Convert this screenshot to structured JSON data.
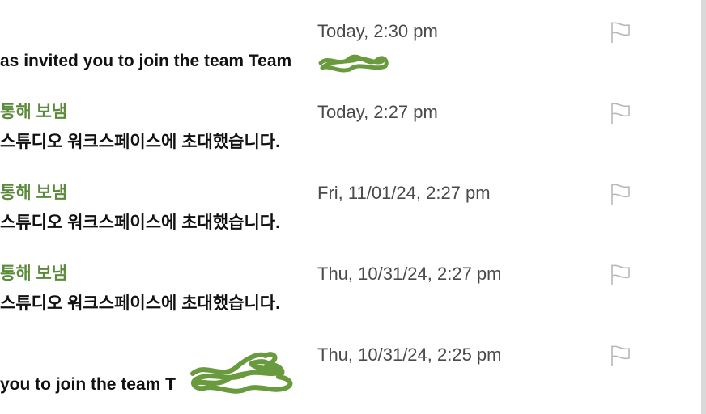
{
  "messages": [
    {
      "sender": "",
      "subject": "as invited you to join the team Team",
      "date": "Today, 2:30 pm"
    },
    {
      "sender": "통해 보냄",
      "subject": "스튜디오 워크스페이스에 초대했습니다.",
      "date": "Today, 2:27 pm"
    },
    {
      "sender": "통해 보냄",
      "subject": "스튜디오 워크스페이스에 초대했습니다.",
      "date": "Fri, 11/01/24, 2:27 pm"
    },
    {
      "sender": "통해 보냄",
      "subject": "스튜디오 워크스페이스에 초대했습니다.",
      "date": "Thu, 10/31/24, 2:27 pm"
    },
    {
      "sender": "",
      "subject": "you to join the team T",
      "date": "Thu, 10/31/24, 2:25 pm"
    }
  ],
  "icons": {
    "flag": "flag-icon",
    "redaction": "redaction-scribble"
  },
  "colors": {
    "sender_green": "#5a8a3a",
    "subject_text": "#111111",
    "date_text": "#4a4a4a",
    "flag_stroke": "#b8b8b8",
    "redaction_green": "#6a9a3e",
    "right_rail": "#d9d9d9"
  }
}
